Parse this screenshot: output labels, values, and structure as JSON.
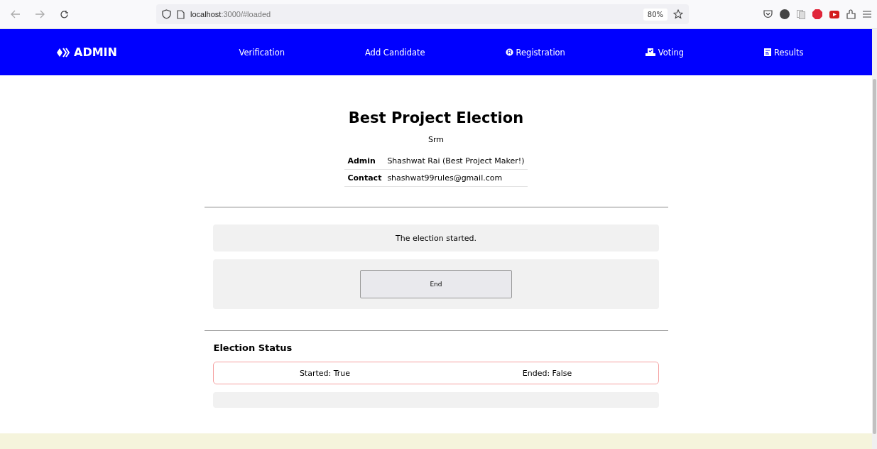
{
  "browser": {
    "url_host": "localhost",
    "url_rest": ":3000/#loaded",
    "zoom": "80%"
  },
  "nav": {
    "brand": "ADMIN",
    "links": [
      {
        "label": "Verification",
        "kind": "plain"
      },
      {
        "label": "Add Candidate",
        "kind": "plain"
      },
      {
        "label": "Registration",
        "kind": "registration"
      },
      {
        "label": "Voting",
        "kind": "voting"
      },
      {
        "label": "Results",
        "kind": "results"
      }
    ]
  },
  "election": {
    "title": "Best Project Election",
    "organization": "Srm",
    "details": [
      {
        "label": "Admin",
        "value": "Shashwat Rai (Best Project Maker!)"
      },
      {
        "label": "Contact",
        "value": "shashwat99rules@gmail.com"
      }
    ]
  },
  "message": "The election started.",
  "end_button": "End",
  "status": {
    "title": "Election Status",
    "items": [
      "Started: True",
      "Ended: False"
    ]
  }
}
